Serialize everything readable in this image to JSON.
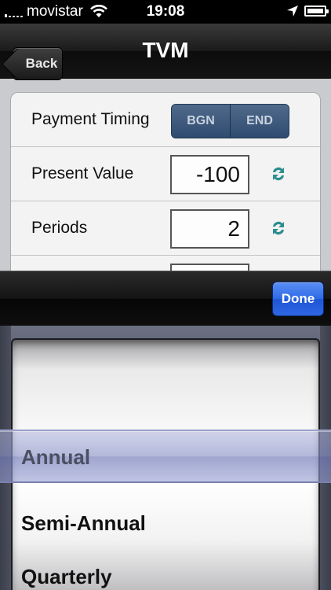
{
  "status_bar": {
    "carrier": "movistar",
    "time": "19:08"
  },
  "nav": {
    "title": "TVM",
    "back_label": "Back"
  },
  "form": {
    "payment_timing": {
      "label": "Payment Timing",
      "options": [
        "BGN",
        "END"
      ]
    },
    "present_value": {
      "label": "Present Value",
      "value": "-100"
    },
    "periods": {
      "label": "Periods",
      "value": "2"
    }
  },
  "toolbar": {
    "done_label": "Done"
  },
  "picker": {
    "selected": "Annual",
    "options": [
      "Annual",
      "Semi-Annual",
      "Quarterly"
    ]
  },
  "colors": {
    "segment_bg": "#3d5a80",
    "done_button": "#2d6ae6",
    "selection_tint": "#8c94c8"
  }
}
